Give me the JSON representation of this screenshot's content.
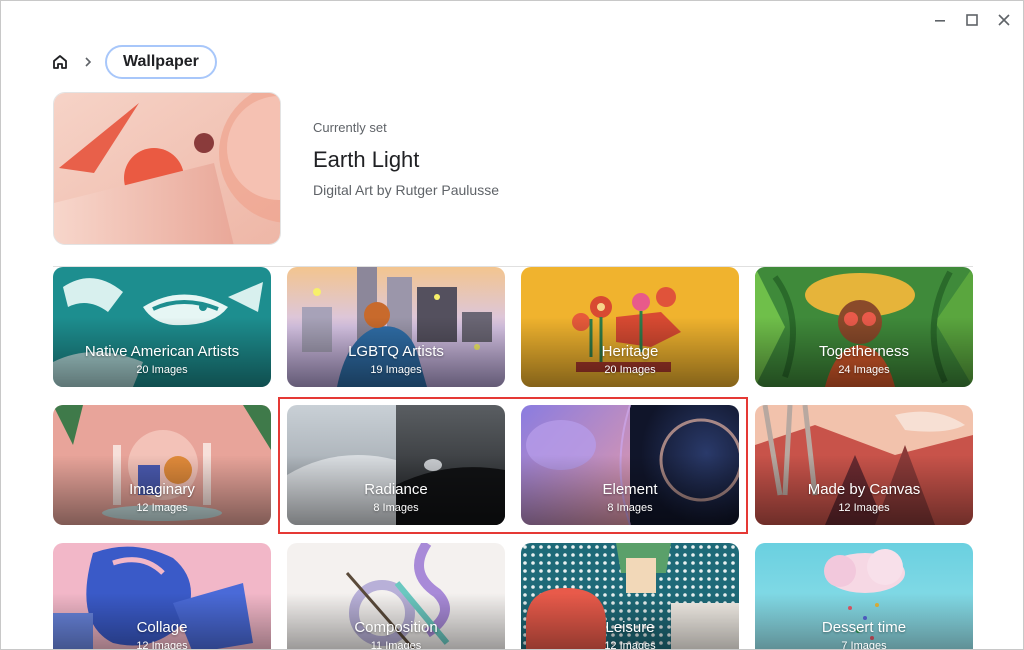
{
  "window": {
    "minimize_icon": "minimize-icon",
    "maximize_icon": "maximize-icon",
    "close_icon": "close-icon"
  },
  "breadcrumb": {
    "home_icon": "home-icon",
    "current": "Wallpaper"
  },
  "current_wallpaper": {
    "label": "Currently set",
    "title": "Earth Light",
    "subtitle": "Digital Art by Rutger Paulusse"
  },
  "collections": [
    {
      "name": "Native American Artists",
      "count": "20 Images"
    },
    {
      "name": "LGBTQ Artists",
      "count": "19 Images"
    },
    {
      "name": "Heritage",
      "count": "20 Images"
    },
    {
      "name": "Togetherness",
      "count": "24 Images"
    },
    {
      "name": "Imaginary",
      "count": "12 Images"
    },
    {
      "name": "Radiance",
      "count": "8 Images"
    },
    {
      "name": "Element",
      "count": "8 Images"
    },
    {
      "name": "Made by Canvas",
      "count": "12 Images"
    },
    {
      "name": "Collage",
      "count": "12 Images"
    },
    {
      "name": "Composition",
      "count": "11 Images"
    },
    {
      "name": "Leisure",
      "count": "12 Images"
    },
    {
      "name": "Dessert time",
      "count": "7 Images"
    }
  ],
  "colors": {
    "highlight": "#e53935",
    "pill_border": "#a8c7fa"
  }
}
